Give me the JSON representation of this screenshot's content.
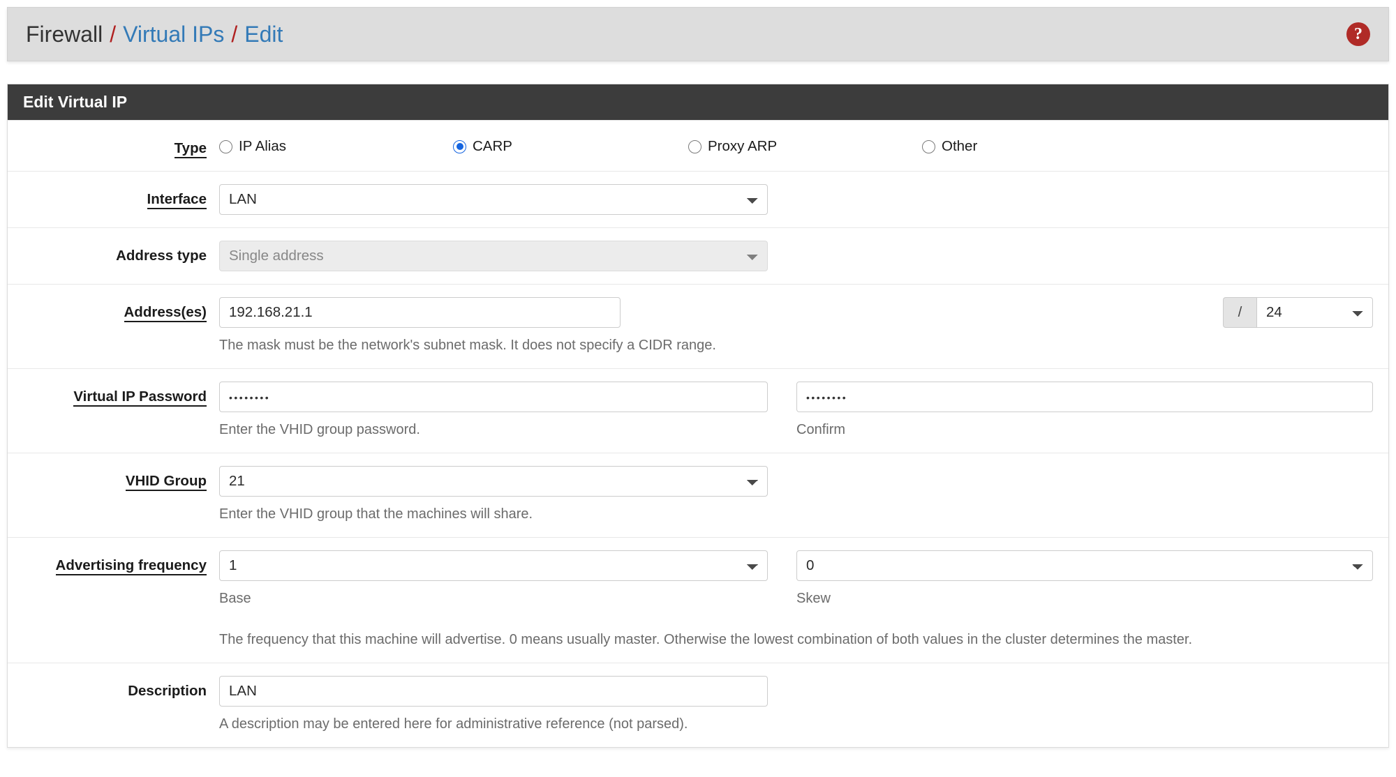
{
  "breadcrumb": {
    "root": "Firewall",
    "separator": "/",
    "link1": "Virtual IPs",
    "link2": "Edit",
    "help_icon": "question-mark-circle-icon",
    "help_glyph": "?"
  },
  "panel": {
    "heading": "Edit Virtual IP"
  },
  "form": {
    "type": {
      "label": "Type",
      "options": [
        {
          "label": "IP Alias",
          "checked": false
        },
        {
          "label": "CARP",
          "checked": true
        },
        {
          "label": "Proxy ARP",
          "checked": false
        },
        {
          "label": "Other",
          "checked": false
        }
      ]
    },
    "interface": {
      "label": "Interface",
      "value": "LAN"
    },
    "address_type": {
      "label": "Address type",
      "value": "Single address",
      "disabled": true
    },
    "addresses": {
      "label": "Address(es)",
      "value": "192.168.21.1",
      "cidr_prefix": "/",
      "cidr_value": "24",
      "help": "The mask must be the network's subnet mask. It does not specify a CIDR range."
    },
    "password": {
      "label": "Virtual IP Password",
      "value": "••••••••",
      "help": "Enter the VHID group password.",
      "confirm_value": "••••••••",
      "confirm_help": "Confirm"
    },
    "vhid_group": {
      "label": "VHID Group",
      "value": "21",
      "help": "Enter the VHID group that the machines will share."
    },
    "advertising_frequency": {
      "label": "Advertising frequency",
      "base_value": "1",
      "base_help": "Base",
      "skew_value": "0",
      "skew_help": "Skew",
      "help": "The frequency that this machine will advertise. 0 means usually master. Otherwise the lowest combination of both values in the cluster determines the master."
    },
    "description": {
      "label": "Description",
      "value": "LAN",
      "help": "A description may be entered here for administrative reference (not parsed)."
    }
  },
  "colors": {
    "header_bg": "#dddddd",
    "panel_heading_bg": "#3c3c3c",
    "link": "#337ab7",
    "separator": "#b02020",
    "help_icon_bg": "#b02b27",
    "radio_checked": "#1565e0"
  }
}
